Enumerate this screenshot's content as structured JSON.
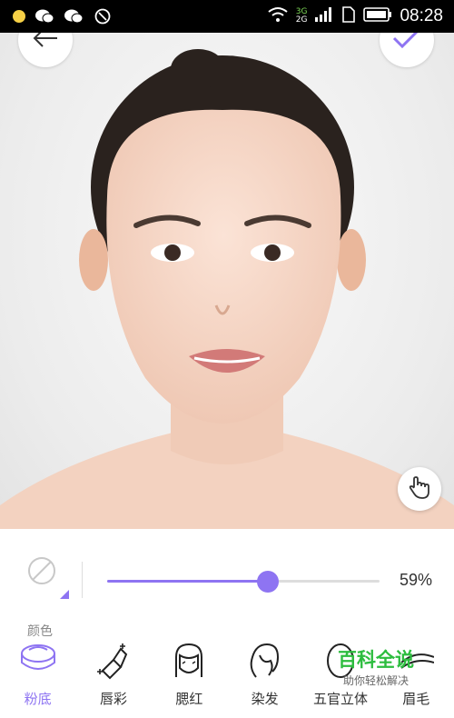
{
  "status": {
    "time": "08:28",
    "net_top": "3G",
    "net_bottom": "2G"
  },
  "editor": {
    "color_label": "颜色",
    "intensity": {
      "value": 59,
      "label": "59%"
    }
  },
  "tabs": [
    {
      "label": "粉底",
      "icon": "foundation-compact-icon",
      "active": true
    },
    {
      "label": "唇彩",
      "icon": "lipstick-icon",
      "active": false
    },
    {
      "label": "腮红",
      "icon": "blush-face-icon",
      "active": false
    },
    {
      "label": "染发",
      "icon": "hair-dye-icon",
      "active": false
    },
    {
      "label": "五官立体",
      "icon": "contour-icon",
      "active": false
    },
    {
      "label": "眉毛",
      "icon": "eyebrow-icon",
      "active": false
    }
  ],
  "watermark": {
    "title": "百科全说",
    "subtitle": "助你轻松解决"
  },
  "colors": {
    "accent": "#8e74f2",
    "watermark_green": "#2dbd3f"
  }
}
